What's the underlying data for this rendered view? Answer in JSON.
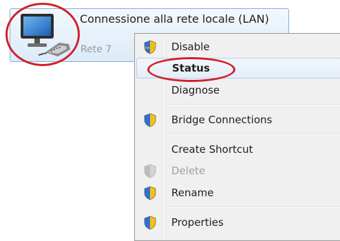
{
  "connection": {
    "name": "Connessione alla rete locale (LAN)",
    "network": "Rete  7",
    "icon": "network-adapter-icon"
  },
  "context_menu": {
    "items": [
      {
        "label": "Disable",
        "icon": "uac-shield-icon"
      },
      {
        "label": "Status",
        "default": true
      },
      {
        "label": "Diagnose"
      },
      {
        "label": "Bridge Connections",
        "icon": "uac-shield-icon"
      },
      {
        "label": "Create Shortcut"
      },
      {
        "label": "Delete",
        "icon": "uac-shield-icon",
        "disabled": true
      },
      {
        "label": "Rename",
        "icon": "uac-shield-icon"
      },
      {
        "label": "Properties",
        "icon": "uac-shield-icon"
      }
    ]
  },
  "highlight_color": "#d12027"
}
